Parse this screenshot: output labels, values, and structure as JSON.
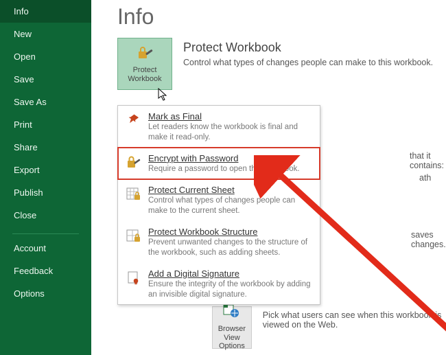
{
  "page_title": "Info",
  "sidebar": {
    "items": [
      {
        "label": "Info"
      },
      {
        "label": "New"
      },
      {
        "label": "Open"
      },
      {
        "label": "Save"
      },
      {
        "label": "Save As"
      },
      {
        "label": "Print"
      },
      {
        "label": "Share"
      },
      {
        "label": "Export"
      },
      {
        "label": "Publish"
      },
      {
        "label": "Close"
      }
    ],
    "lower": [
      {
        "label": "Account"
      },
      {
        "label": "Feedback"
      },
      {
        "label": "Options"
      }
    ]
  },
  "protect": {
    "tile_label": "Protect Workbook",
    "heading": "Protect Workbook",
    "desc": "Control what types of changes people can make to this workbook."
  },
  "contains_lines": {
    "a": "that it contains:",
    "b": "ath"
  },
  "saves_changes": "saves changes.",
  "browser_view": {
    "tile_label": "Browser View Options",
    "desc": "Pick what users can see when this workbook is viewed on the Web."
  },
  "menu": {
    "items": [
      {
        "title": "Mark as Final",
        "desc": "Let readers know the workbook is final and make it read-only."
      },
      {
        "title": "Encrypt with Password",
        "desc": "Require a password to open this workbook."
      },
      {
        "title": "Protect Current Sheet",
        "desc": "Control what types of changes people can make to the current sheet."
      },
      {
        "title": "Protect Workbook Structure",
        "desc": "Prevent unwanted changes to the structure of the workbook, such as adding sheets."
      },
      {
        "title": "Add a Digital Signature",
        "desc": "Ensure the integrity of the workbook by adding an invisible digital signature."
      }
    ]
  }
}
